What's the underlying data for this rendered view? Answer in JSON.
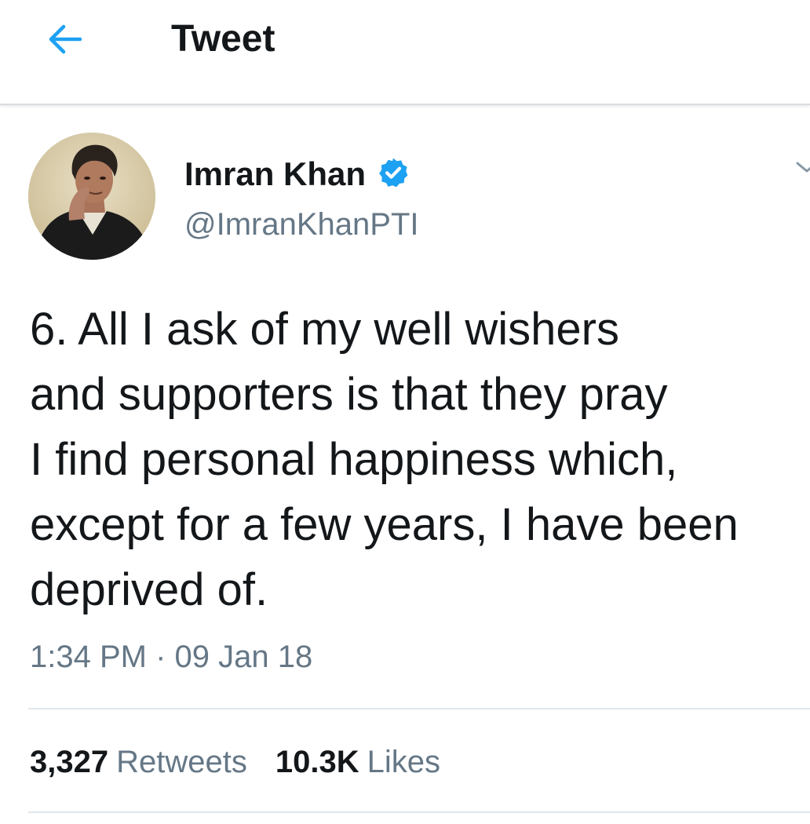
{
  "header": {
    "back_icon": "arrow-left-icon",
    "title": "Tweet"
  },
  "author": {
    "display_name": "Imran Khan",
    "handle": "@ImranKhanPTI",
    "verified_icon": "verified-badge-icon",
    "avatar": "profile-photo"
  },
  "tweet": {
    "lines": [
      "6. All I ask of my well wishers",
      "and supporters is that they pray",
      "I find personal happiness which,",
      "except for a few years, I have been",
      "deprived of."
    ],
    "timestamp": "1:34 PM · 09 Jan 18"
  },
  "stats": {
    "retweets_count": "3,327",
    "retweets_label": "Retweets",
    "likes_count": "10.3K",
    "likes_label": "Likes"
  },
  "colors": {
    "accent": "#1da1f2",
    "text_primary": "#14171a",
    "text_secondary": "#657786",
    "divider": "#e1e8ed"
  }
}
